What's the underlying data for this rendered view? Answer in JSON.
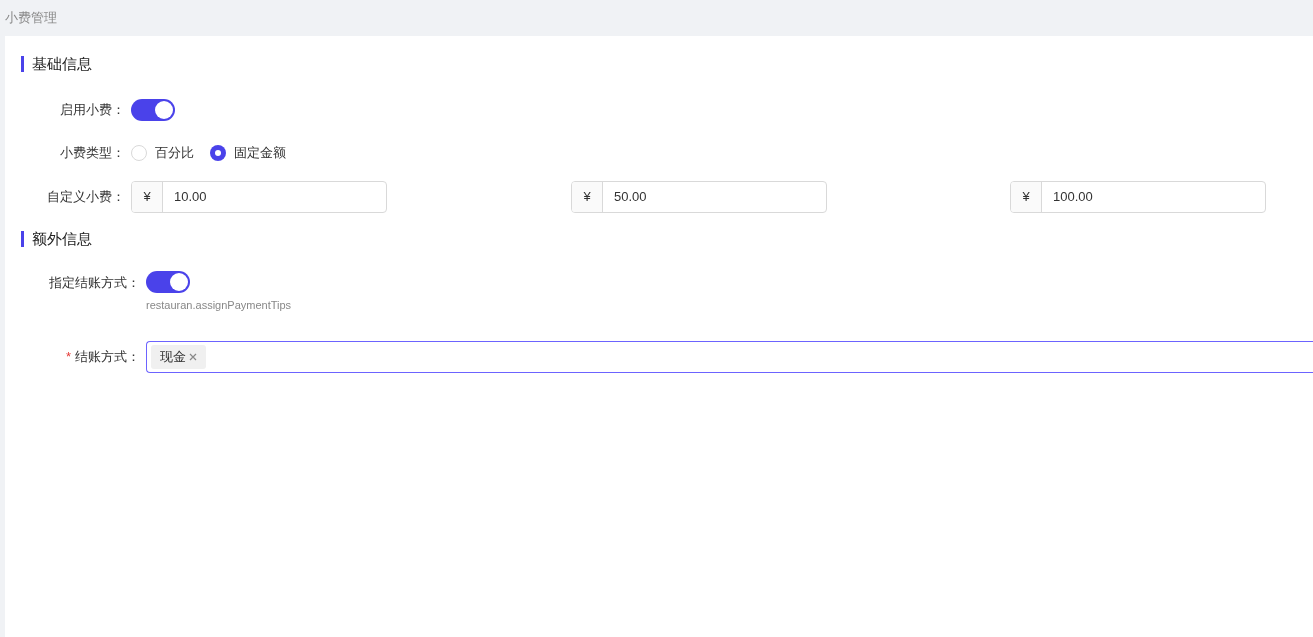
{
  "page_title": "小费管理",
  "basic": {
    "title": "基础信息",
    "enable": {
      "label": "启用小费：",
      "on": true
    },
    "type": {
      "label": "小费类型：",
      "options": [
        {
          "label": "百分比",
          "selected": false
        },
        {
          "label": "固定金额",
          "selected": true
        }
      ]
    },
    "custom": {
      "label": "自定义小费：",
      "inputs": [
        {
          "prefix": "¥",
          "value": "10.00"
        },
        {
          "prefix": "¥",
          "value": "50.00"
        },
        {
          "prefix": "¥",
          "value": "100.00"
        }
      ]
    }
  },
  "extra": {
    "title": "额外信息",
    "assign": {
      "label": "指定结账方式：",
      "on": true,
      "hint": "restauran.assignPaymentTips"
    },
    "payment": {
      "label": "结账方式：",
      "required_mark": "*",
      "tags": [
        {
          "label": "现金"
        }
      ]
    }
  }
}
